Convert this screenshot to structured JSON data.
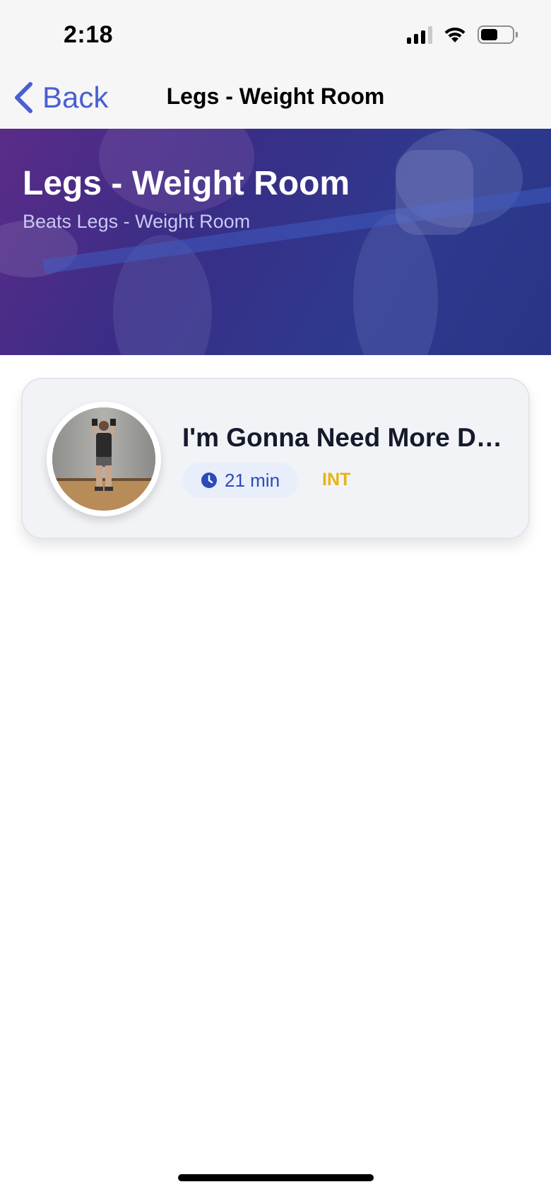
{
  "status_bar": {
    "time": "2:18"
  },
  "nav": {
    "back_label": "Back",
    "title": "Legs - Weight Room"
  },
  "hero": {
    "title": "Legs - Weight Room",
    "subtitle": "Beats Legs - Weight Room"
  },
  "workouts": [
    {
      "title": "I'm Gonna Need More Du...",
      "duration": "21 min",
      "level": "INT"
    }
  ],
  "colors": {
    "accent": "#4a5fd1",
    "level": "#e8b312",
    "duration": "#2d4ab8"
  }
}
